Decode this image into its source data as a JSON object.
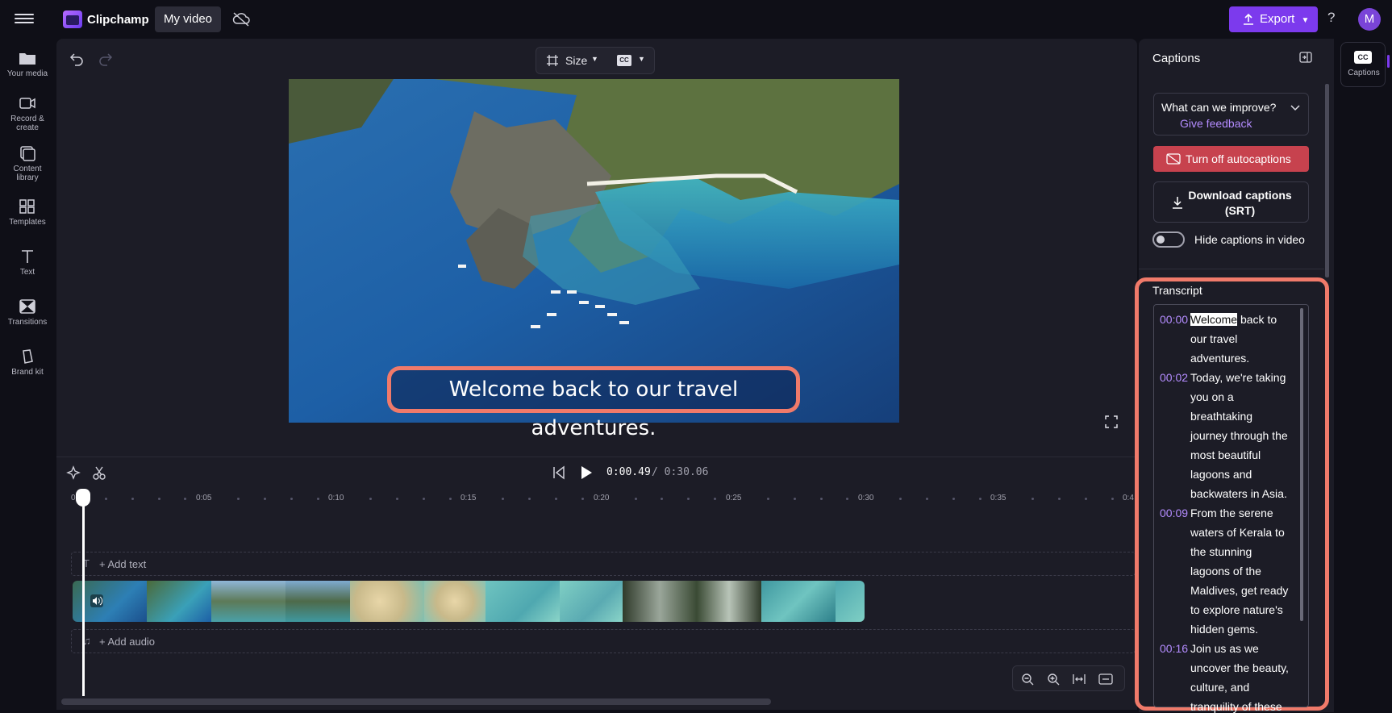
{
  "app": {
    "name": "Clipchamp",
    "project_name": "My video",
    "export_label": "Export",
    "help": "?",
    "avatar": "M",
    "accent": "#7c3aed"
  },
  "rail": [
    {
      "line1": "Your media",
      "line2": "",
      "icon": "folder-icon"
    },
    {
      "line1": "Record &",
      "line2": "create",
      "icon": "camera-icon"
    },
    {
      "line1": "Content",
      "line2": "library",
      "icon": "library-icon"
    },
    {
      "line1": "Templates",
      "line2": "",
      "icon": "templates-icon"
    },
    {
      "line1": "Text",
      "line2": "",
      "icon": "text-icon"
    },
    {
      "line1": "Transitions",
      "line2": "",
      "icon": "transitions-icon"
    },
    {
      "line1": "Brand kit",
      "line2": "",
      "icon": "brand-kit-icon"
    }
  ],
  "preview": {
    "size_label": "Size",
    "caption": "Welcome back to our travel adventures."
  },
  "playback": {
    "current": "0:00.49",
    "total": "/ 0:30.06"
  },
  "timeline": {
    "ticks": [
      "0",
      "0:05",
      "0:10",
      "0:15",
      "0:20",
      "0:25",
      "0:30",
      "0:35",
      "0:4"
    ],
    "add_text": "+ Add text",
    "add_audio": "+ Add audio"
  },
  "captions_panel": {
    "title": "Captions",
    "feedback_question": "What can we improve?",
    "feedback_link": "Give feedback",
    "turn_off": "Turn off autocaptions",
    "download_line1": "Download captions",
    "download_line2": "(SRT)",
    "hide_label": "Hide captions in video",
    "hide_enabled": false,
    "transcript_label": "Transcript",
    "entries": [
      {
        "time": "00:00",
        "lines": [
          "Welcome back to",
          "our travel",
          "adventures."
        ],
        "highlight_word": "Welcome"
      },
      {
        "time": "00:02",
        "lines": [
          "Today, we're taking",
          "you on a",
          "breathtaking",
          "journey through the",
          "most beautiful",
          "lagoons and",
          "backwaters in Asia."
        ]
      },
      {
        "time": "00:09",
        "lines": [
          "From the serene",
          "waters of Kerala to",
          "the stunning",
          "lagoons of the",
          "Maldives, get ready",
          "to explore nature's",
          "hidden gems."
        ]
      },
      {
        "time": "00:16",
        "lines": [
          "Join us as we",
          "uncover the beauty,",
          "culture, and",
          "tranquility of these"
        ]
      }
    ]
  },
  "right_rail": {
    "cc_label": "Captions",
    "cc_badge": "CC"
  }
}
